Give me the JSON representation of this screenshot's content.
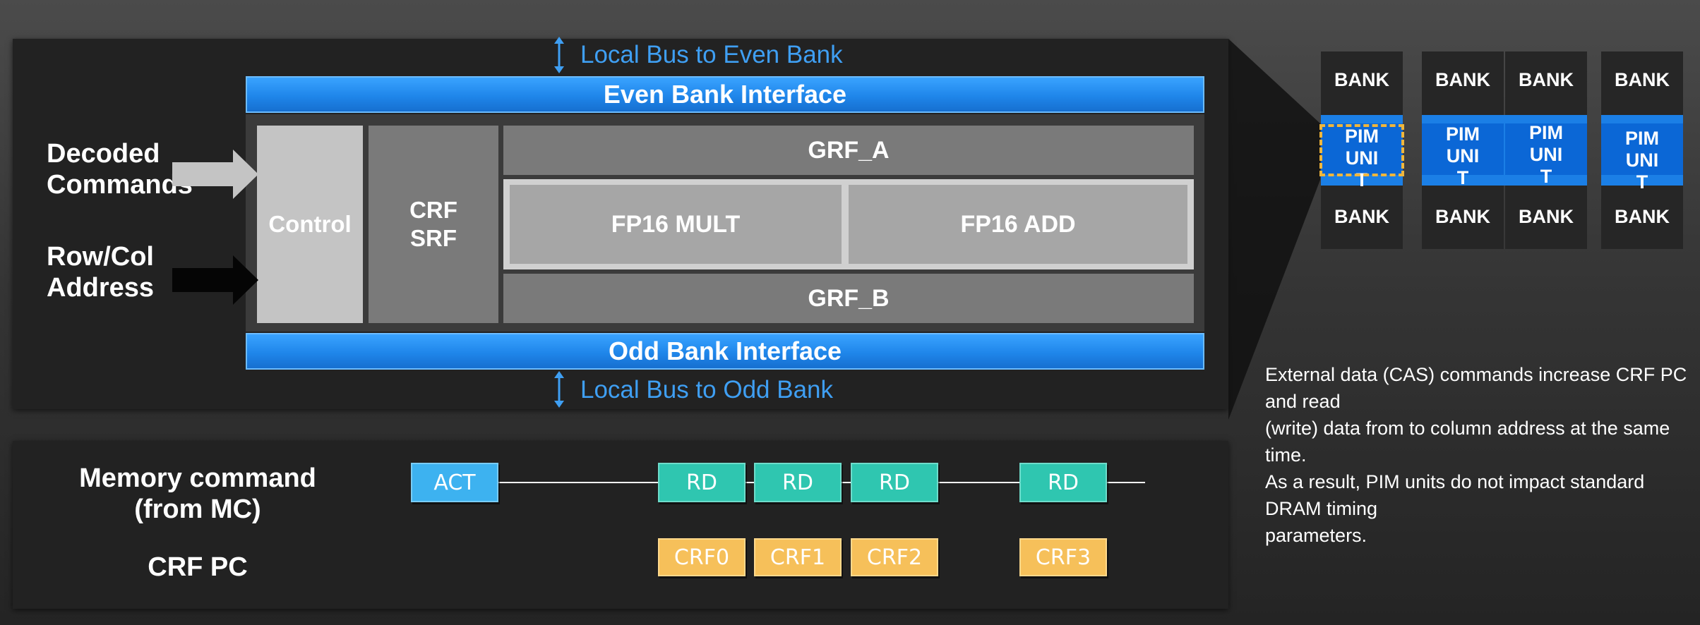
{
  "colors": {
    "bus_blue": "#1f86ea",
    "act_blue": "#3db2f0",
    "rd_teal": "#2fc6b0",
    "crf_orange": "#f6c05a",
    "label_blue": "#3f9ff3",
    "control_gray": "#c4c4c4",
    "unit_gray": "#7a7a7a",
    "dashed_highlight": "#f0b63c"
  },
  "pim": {
    "local_bus_even": "Local Bus to Even Bank",
    "local_bus_odd": "Local Bus to Odd Bank",
    "even_bank_interface": "Even Bank Interface",
    "odd_bank_interface": "Odd Bank Interface",
    "control": "Control",
    "crf": "CRF",
    "srf": "SRF",
    "grf_a": "GRF_A",
    "grf_b": "GRF_B",
    "fp16_mult": "FP16 MULT",
    "fp16_add": "FP16 ADD",
    "decoded_commands": [
      "Decoded",
      "Commands"
    ],
    "row_col_address": [
      "Row/Col",
      "Address"
    ]
  },
  "timing": {
    "memory_command": [
      "Memory command",
      "(from MC)"
    ],
    "crf_pc": "CRF PC",
    "commands": [
      "ACT",
      "RD",
      "RD",
      "RD",
      "RD"
    ],
    "crf_values": [
      "CRF0",
      "CRF1",
      "CRF2",
      "CRF3"
    ]
  },
  "banks": {
    "bank_label": "BANK",
    "pim_unit": [
      "PIM",
      "UNI",
      "T"
    ]
  },
  "note": [
    "External data (CAS) commands increase CRF PC and read",
    "(write) data from to column address at the same time.",
    "As a result, PIM units do not impact standard DRAM timing",
    "parameters."
  ]
}
